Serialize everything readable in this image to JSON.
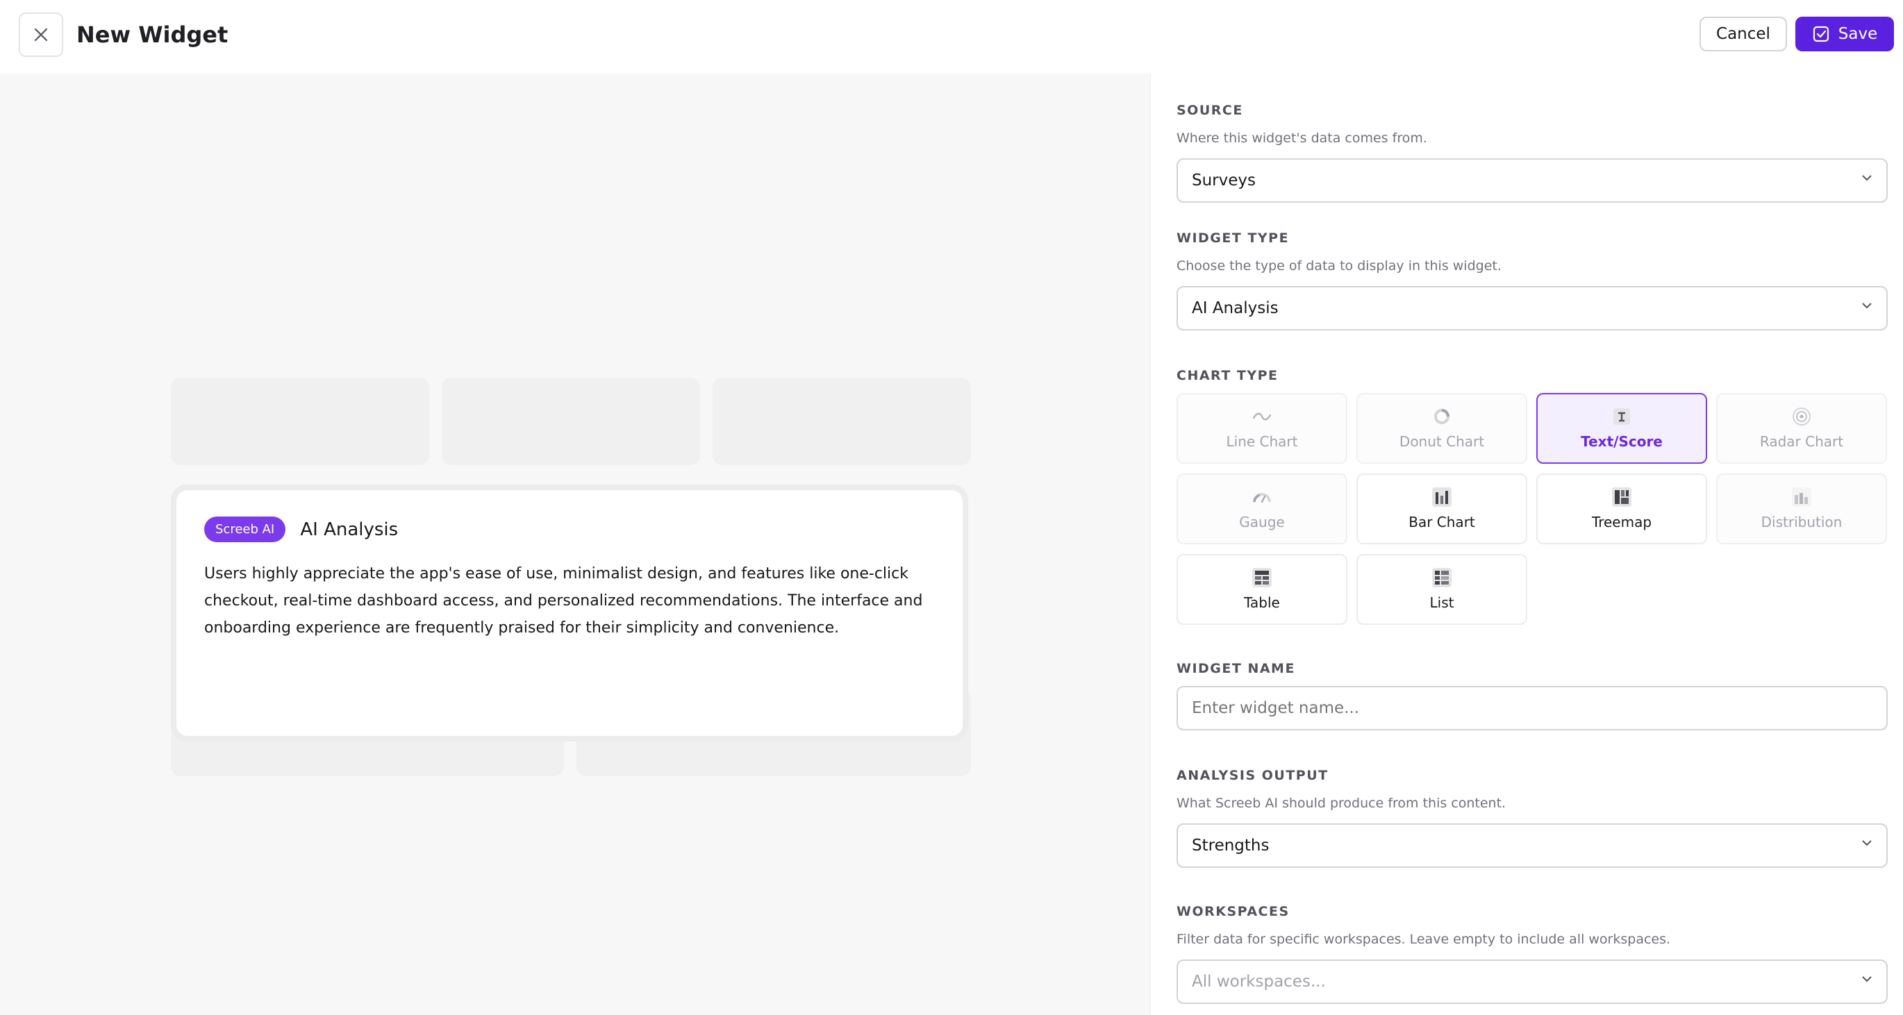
{
  "header": {
    "title": "New Widget",
    "cancel_label": "Cancel",
    "save_label": "Save"
  },
  "preview": {
    "badge": "Screeb AI",
    "title": "AI Analysis",
    "body": "Users highly appreciate the app's ease of use, minimalist design, and features like one-click checkout, real-time dashboard access, and personalized recommendations. The interface and onboarding experience are frequently praised for their simplicity and convenience."
  },
  "panel": {
    "source": {
      "label": "SOURCE",
      "help": "Where this widget's data comes from.",
      "value": "Surveys"
    },
    "widget_type": {
      "label": "WIDGET TYPE",
      "help": "Choose the type of data to display in this widget.",
      "value": "AI Analysis"
    },
    "chart_type": {
      "label": "CHART TYPE",
      "selected": "Text/Score",
      "options": [
        {
          "label": "Line Chart",
          "icon": "line-chart-icon",
          "state": "disabled"
        },
        {
          "label": "Donut Chart",
          "icon": "donut-chart-icon",
          "state": "disabled"
        },
        {
          "label": "Text/Score",
          "icon": "text-score-icon",
          "state": "selected"
        },
        {
          "label": "Radar Chart",
          "icon": "radar-chart-icon",
          "state": "disabled"
        },
        {
          "label": "Gauge",
          "icon": "gauge-icon",
          "state": "disabled"
        },
        {
          "label": "Bar Chart",
          "icon": "bar-chart-icon",
          "state": "enabled"
        },
        {
          "label": "Treemap",
          "icon": "treemap-icon",
          "state": "enabled"
        },
        {
          "label": "Distribution",
          "icon": "distribution-icon",
          "state": "disabled"
        },
        {
          "label": "Table",
          "icon": "table-icon",
          "state": "enabled"
        },
        {
          "label": "List",
          "icon": "list-icon",
          "state": "enabled"
        }
      ]
    },
    "widget_name": {
      "label": "WIDGET NAME",
      "placeholder": "Enter widget name..."
    },
    "analysis_output": {
      "label": "ANALYSIS OUTPUT",
      "help": "What Screeb AI should produce from this content.",
      "value": "Strengths"
    },
    "workspaces": {
      "label": "WORKSPACES",
      "help": "Filter data for specific workspaces. Leave empty to include all workspaces.",
      "placeholder": "All workspaces..."
    }
  },
  "colors": {
    "accent": "#5b21e0",
    "badge": "#7c3aed",
    "selected_bg": "#f3efff"
  }
}
